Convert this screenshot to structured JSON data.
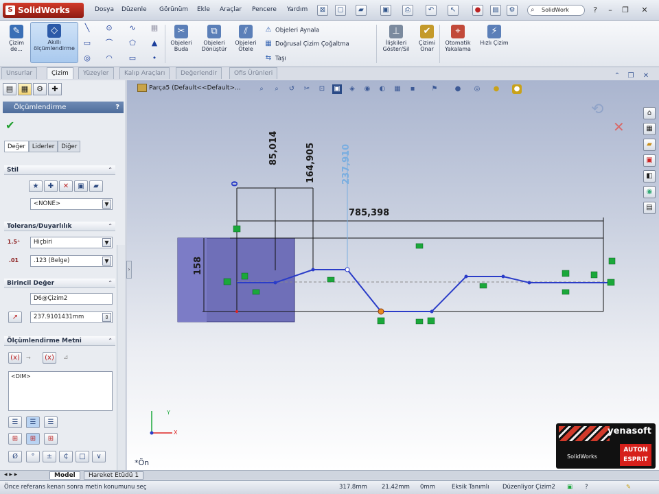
{
  "app": {
    "logo": "SolidWorks"
  },
  "menu": [
    "Dosya",
    "Düzenle",
    "Görünüm",
    "Ekle",
    "Araçlar",
    "Pencere",
    "Yardım"
  ],
  "search": {
    "value": "SolidWork"
  },
  "ribbon": {
    "cizim_label": "Çizim de...",
    "akilli_label": "Akıllı ölçümlendirme",
    "budama_label": "Objeleri Buda",
    "donustur_label": "Objeleri Dönüştür",
    "otele_label": "Objeleri Ötele",
    "aynala_label": "Objeleri Aynala",
    "cogaltma_label": "Doğrusal Çizim Çoğaltma",
    "tasi_label": "Taşı",
    "iliskiler_label": "İlişkileri Göster/Sil",
    "onar_label": "Çizimi Onar",
    "yakalama_label": "Otomatik Yakalama",
    "hizli_label": "Hızlı Çizim"
  },
  "tabs": [
    "Unsurlar",
    "Çizim",
    "Yüzeyler",
    "Kalıp Araçları",
    "Değerlendir",
    "Ofis Ürünleri"
  ],
  "active_tab": "Çizim",
  "property_manager": {
    "title": "Ölçümlendirme",
    "help": "?",
    "sub_tabs": [
      "Değer",
      "Liderler",
      "Diğer"
    ],
    "style": {
      "header": "Stil",
      "value": "<NONE>"
    },
    "tolerance": {
      "header": "Tolerans/Duyarlılık",
      "type": "Hiçbiri",
      "precision": ".123 (Belge)"
    },
    "primary": {
      "header": "Birincil Değer",
      "name": "D6@Çizim2",
      "value": "237.9101431mm"
    },
    "dim_text": {
      "header": "Ölçümlendirme Metni",
      "content": "<DIM>"
    }
  },
  "canvas": {
    "breadcrumb": "Parça5  (Default<<Default>...",
    "dimensions": {
      "d1": "85,014",
      "d2": "164,905",
      "d3": "237,910",
      "d4": "785,398",
      "d5": "158",
      "d6": "0"
    },
    "view_label": "*Ön",
    "triad_x": "X",
    "triad_y": "Y",
    "branding": {
      "company": "yenasoft",
      "sw": "SolidWorks",
      "autonesprit": "AUTON ESPRIT"
    }
  },
  "model_tabs": [
    "Model",
    "Hareket Etüdü 1"
  ],
  "status": {
    "hint": "Önce referans kenarı sonra metin konumunu seç",
    "x": "317.8mm",
    "y": "21.42mm",
    "z": "0mm",
    "definition": "Eksik Tanımlı",
    "editing": "Düzenliyor Çizim2"
  },
  "colors": {
    "accent": "#4d6c9b",
    "sketch_line": "#2a3cc8",
    "relation": "#1aa83a",
    "selected_dim": "#7aaee0"
  }
}
